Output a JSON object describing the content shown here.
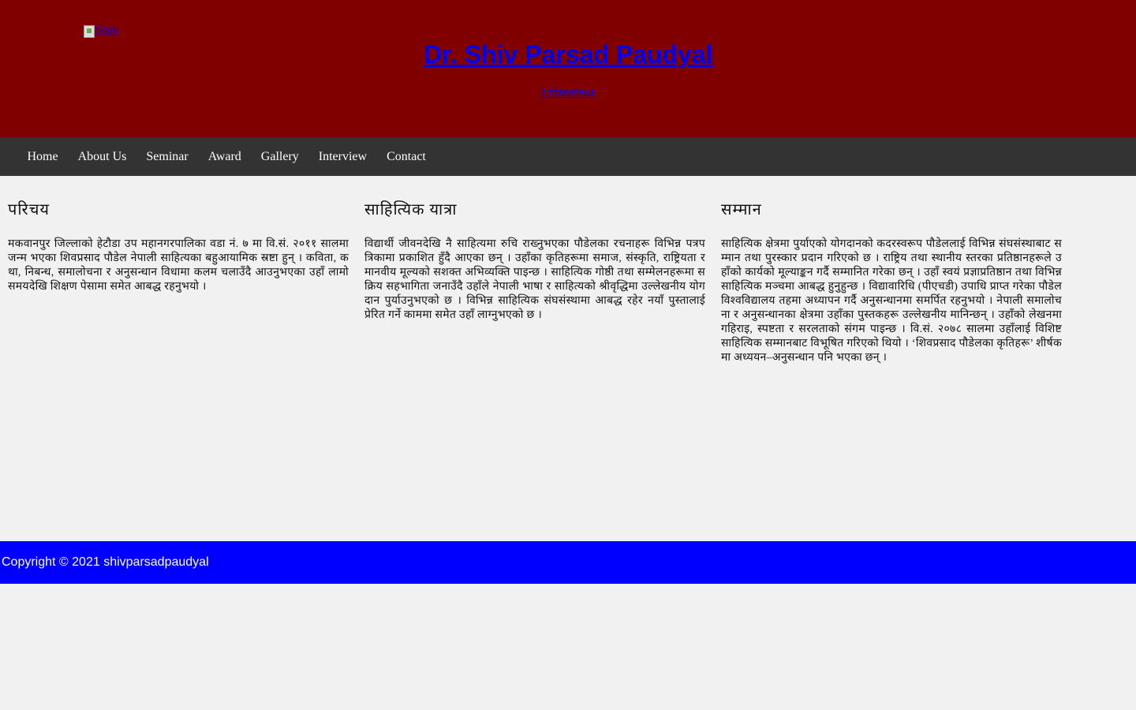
{
  "header": {
    "logo_alt": "Shiv",
    "title": "Dr. Shiv Parsad Paudyal",
    "tagline": "Litterateur",
    "background_color": "#800000",
    "link_color": "#0000ee"
  },
  "nav": {
    "background_color": "#333333",
    "items": [
      {
        "label": "Home"
      },
      {
        "label": "About Us"
      },
      {
        "label": "Seminar"
      },
      {
        "label": "Award"
      },
      {
        "label": "Gallery"
      },
      {
        "label": "Interview"
      },
      {
        "label": "Contact"
      }
    ]
  },
  "columns": [
    {
      "heading": "परिचय",
      "body": "मकवानपुर जिल्लाको हेटौडा उप महानगरपालिका वडा नं. ७ मा वि.सं. २०११ सालमा जन्म भएका शिवप्रसाद पौडेल नेपाली साहित्यका बहुआयामिक स्रष्टा हुन् । कविता, कथा, निबन्ध, समालोचना र अनुसन्धान विधामा कलम चलाउँदै आउनुभएका उहाँ लामो समयदेखि शिक्षण पेसामा समेत आबद्ध रहनुभयो ।"
    },
    {
      "heading": "साहित्यिक यात्रा",
      "body": "विद्यार्थी जीवनदेखि नै साहित्यमा रुचि राख्नुभएका पौडेलका रचनाहरू विभिन्न पत्रपत्रिकामा प्रकाशित हुँदै आएका छन् । उहाँका कृतिहरूमा समाज, संस्कृति, राष्ट्रियता र मानवीय मूल्यको सशक्त अभिव्यक्ति पाइन्छ । साहित्यिक गोष्ठी तथा सम्मेलनहरूमा सक्रिय सहभागिता जनाउँदै उहाँले नेपाली भाषा र साहित्यको श्रीवृद्धिमा उल्लेखनीय योगदान पुर्याउनुभएको छ । विभिन्न साहित्यिक संघसंस्थामा आबद्ध रहेर नयाँ पुस्तालाई प्रेरित गर्ने काममा समेत उहाँ लाग्नुभएको छ ।"
    },
    {
      "heading": "सम्मान",
      "body": "साहित्यिक क्षेत्रमा पुर्याएको योगदानको कदरस्वरूप पौडेललाई विभिन्न संघसंस्थाबाट सम्मान तथा पुरस्कार प्रदान गरिएको छ । राष्ट्रिय तथा स्थानीय स्तरका प्रतिष्ठानहरूले उहाँको कार्यको मूल्याङ्कन गर्दै सम्मानित गरेका छन् । उहाँ स्वयं प्रज्ञाप्रतिष्ठान तथा विभिन्न साहित्यिक मञ्चमा आबद्ध हुनुहुन्छ । विद्यावारिधि (पीएचडी) उपाधि प्राप्त गरेका पौडेल विश्वविद्यालय तहमा अध्यापन गर्दै अनुसन्धानमा समर्पित रहनुभयो । नेपाली समालोचना र अनुसन्धानका क्षेत्रमा उहाँका पुस्तकहरू उल्लेखनीय मानिन्छन् । उहाँको लेखनमा गहिराइ, स्पष्टता र सरलताको संगम पाइन्छ । वि.सं. २०७८ सालमा उहाँलाई विशिष्ट साहित्यिक सम्मानबाट विभूषित गरिएको थियो । ‘शिवप्रसाद पौडेलका कृतिहरू’ शीर्षकमा अध्ययन–अनुसन्धान पनि भएका छन् ।"
    }
  ],
  "footer": {
    "text": "Copyright © 2021 shivparsadpaudyal",
    "background_color": "#0000ff"
  }
}
